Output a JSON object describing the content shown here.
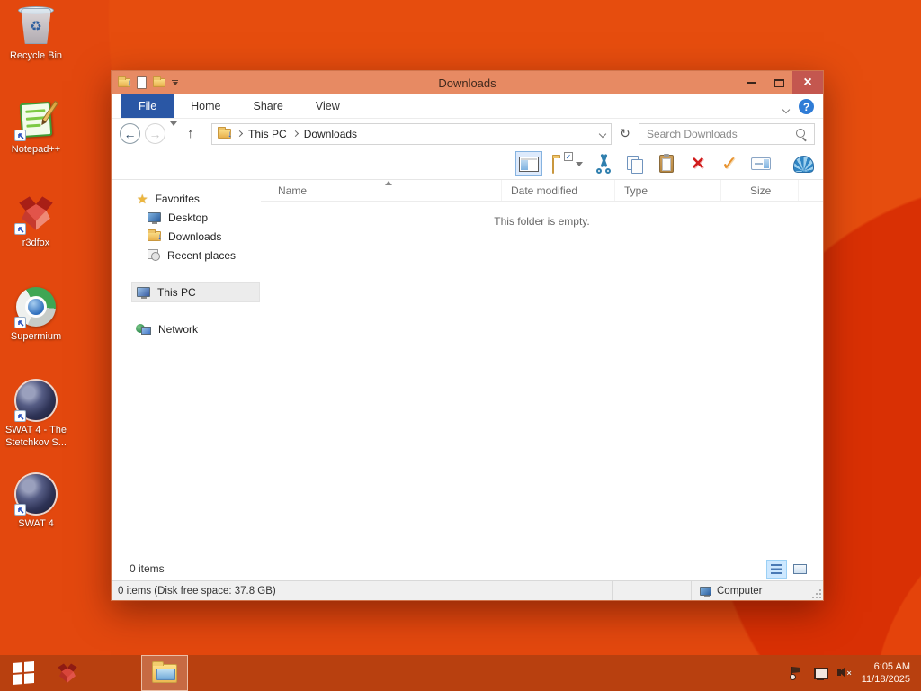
{
  "colors": {
    "desktop_orange": "#e3480e",
    "wallpaper_circle_red": "#d93004",
    "titlebar_salmon": "#e78a63",
    "file_tab_blue": "#2a57a5",
    "close_button_red": "#c4574f",
    "taskbar_rust": "#b8400f",
    "selection_blue": "#cde8ff"
  },
  "desktop": {
    "icons": [
      {
        "label": "Recycle Bin"
      },
      {
        "label": "Notepad++"
      },
      {
        "label": "r3dfox"
      },
      {
        "label": "Supermium"
      },
      {
        "label": "SWAT 4 - The Stetchkov S..."
      },
      {
        "label": "SWAT 4"
      }
    ]
  },
  "window": {
    "title": "Downloads",
    "tabs": {
      "file": "File",
      "home": "Home",
      "share": "Share",
      "view": "View"
    },
    "address": {
      "crumbs": [
        "This PC",
        "Downloads"
      ]
    },
    "search": {
      "placeholder": "Search Downloads"
    },
    "sidebar": {
      "favorites": "Favorites",
      "favorites_items": [
        "Desktop",
        "Downloads",
        "Recent places"
      ],
      "this_pc": "This PC",
      "network": "Network"
    },
    "columns": [
      "Name",
      "Date modified",
      "Type",
      "Size"
    ],
    "empty_message": "This folder is empty.",
    "status": {
      "item_count": "0 items",
      "free_space": "0 items (Disk free space: 37.8 GB)",
      "computer": "Computer"
    }
  },
  "taskbar": {
    "clock": {
      "time": "6:05 AM",
      "date": "11/18/2025"
    }
  }
}
